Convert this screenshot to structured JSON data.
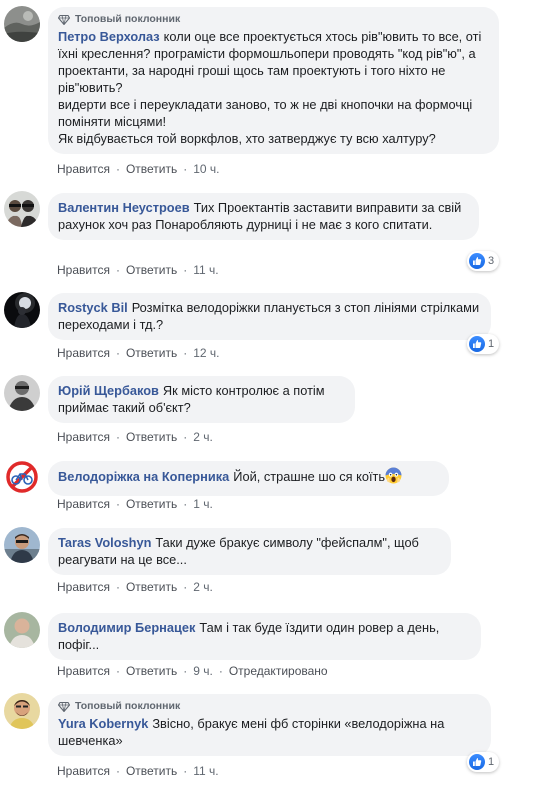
{
  "labels": {
    "like": "Нравится",
    "reply": "Ответить",
    "dot": "·"
  },
  "comments": [
    {
      "badge": "Топовый поклонник",
      "author": "Петро Верхолаз",
      "text": "коли оце все проектується хтось рів\"ювить то все, оті їхні креслення? програмісти формошльопери проводять \"код рів\"ю\", а проектанти, за народні гроші щось там проектують і того ніхто не рів\"ювить?\nвидерти все і переукладати заново, то ж не дві кнопочки на формочці поміняти місцями!\nЯк відбувається той воркфлов, хто затверджує ту всю халтуру?",
      "time": "10 ч."
    },
    {
      "author": "Валентин Неустроев",
      "text": "Тих Проектантів заставити виправити за свій рахунок хоч раз Понаробляють дурниці і не має з кого спитати.",
      "time": "11 ч.",
      "reactions": "3"
    },
    {
      "author": "Rostyck Bil",
      "text": "Розмітка велодоріжки планується з стоп лініями стрілками переходами і тд.?",
      "time": "12 ч.",
      "reactions": "1"
    },
    {
      "author": "Юрій Щербаков",
      "text": "Як місто контролює а потім приймає такий об'єкт?",
      "time": "2 ч."
    },
    {
      "author": "Велодоріжка на Коперника",
      "text": "Йой, страшне шо ся коїть",
      "time": "1 ч."
    },
    {
      "author": "Taras Voloshyn",
      "text": "Таки дуже бракує символу \"фейспалм\", щоб реагувати на це все...",
      "time": "2 ч."
    },
    {
      "author": "Володимир Бернацек",
      "text": "Там і так буде їздити один ровер а день, пофіг...",
      "time": "9 ч.",
      "edited": "Отредактировано"
    },
    {
      "badge": "Топовый поклонник",
      "author": "Yura Kobernyk",
      "text": "Звісно, бракує мені фб сторінки «велодоріжна на шевченка»",
      "time": "11 ч.",
      "reactions": "1"
    }
  ],
  "colors": {
    "author": "#385898",
    "bubble": "#f2f3f5",
    "meta": "#606770",
    "like": "#1869e4"
  },
  "icons": {
    "badge": "diamond-icon",
    "like": "thumbs-up-icon",
    "emoji": "scream-emoji-icon"
  }
}
